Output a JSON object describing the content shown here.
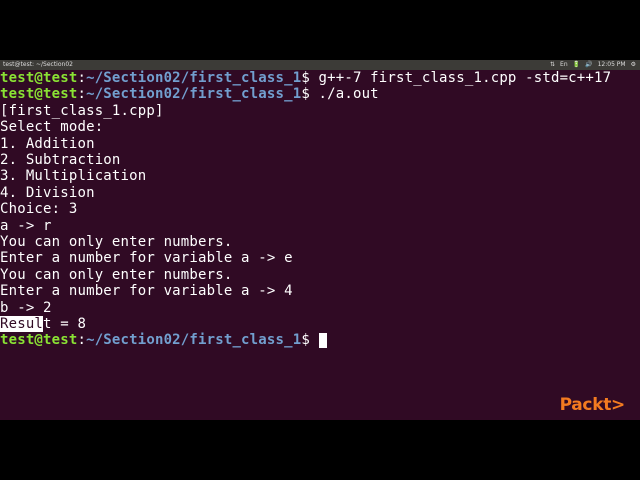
{
  "topbar": {
    "title": "test@test: ~/Section02",
    "tray": [
      "⇅",
      "En",
      "🔋",
      "🔊",
      "12:05 PM",
      "⚙"
    ]
  },
  "terminal": {
    "prompt_user": "test@test",
    "prompt_sep": ":",
    "prompt_path": "~/Section02/first_class_1",
    "prompt_end": "$ ",
    "command_1": "g++-7 first_class_1.cpp -std=c++17",
    "command_2": "./a.out",
    "output": [
      "[first_class_1.cpp]",
      "Select mode:",
      "1. Addition",
      "2. Subtraction",
      "3. Multiplication",
      "4. Division",
      "Choice: 3",
      "a -> r",
      "You can only enter numbers.",
      "Enter a number for variable a -> e",
      "You can only enter numbers.",
      "Enter a number for variable a -> 4",
      "b -> 2"
    ],
    "result_selected": "Resul",
    "result_rest": "t = 8"
  },
  "watermark": "Packt>"
}
